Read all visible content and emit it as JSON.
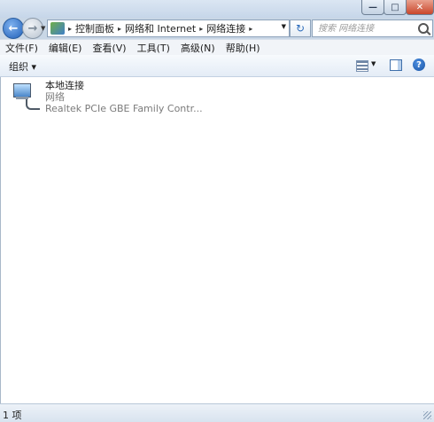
{
  "window": {
    "minimize_symbol": "—",
    "maximize_symbol": "□",
    "close_symbol": "✕"
  },
  "nav": {
    "back_symbol": "←",
    "forward_symbol": "→",
    "recent_dropdown_symbol": "▼"
  },
  "address_bar": {
    "crumbs": [
      "控制面板",
      "网络和 Internet",
      "网络连接"
    ],
    "separator": "▸",
    "dropdown_symbol": "▼"
  },
  "refresh": {
    "symbol": "↻"
  },
  "search": {
    "placeholder": "搜索 网络连接"
  },
  "menu": {
    "items": [
      "文件(F)",
      "编辑(E)",
      "查看(V)",
      "工具(T)",
      "高级(N)",
      "帮助(H)"
    ]
  },
  "toolbar": {
    "organize_label": "组织 ▾",
    "views_dropdown_symbol": "▼",
    "help_symbol": "?"
  },
  "content": {
    "items": [
      {
        "name": "本地连接",
        "status": "网络",
        "device": "Realtek PCIe GBE Family Contr..."
      }
    ]
  },
  "statusbar": {
    "count_text": "1 项"
  },
  "icons": {
    "back": "back-arrow-icon",
    "forward": "forward-arrow-icon",
    "address": "network-folder-icon",
    "refresh": "refresh-icon",
    "search": "search-icon",
    "views": "views-icon",
    "preview": "preview-pane-icon",
    "help": "help-icon",
    "item": "network-connection-icon"
  },
  "colors": {
    "frame": "#c9d7e6",
    "close_button": "#c9462b",
    "accent": "#1f5fb8"
  }
}
